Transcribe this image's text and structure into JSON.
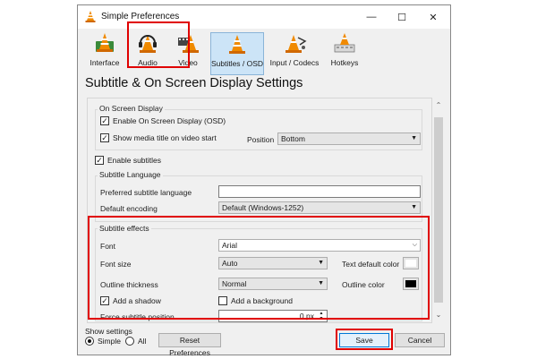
{
  "window": {
    "title": "Simple Preferences",
    "controls": {
      "minimize": "—",
      "maximize": "☐",
      "close": "✕"
    }
  },
  "toolbar": {
    "items": [
      {
        "label": "Interface",
        "icon": "interface-cone-icon"
      },
      {
        "label": "Audio",
        "icon": "headphones-cone-icon"
      },
      {
        "label": "Video",
        "icon": "video-cone-icon"
      },
      {
        "label": "Subtitles / OSD",
        "icon": "subtitles-cone-icon",
        "selected": true
      },
      {
        "label": "Input / Codecs",
        "icon": "input-cone-icon"
      },
      {
        "label": "Hotkeys",
        "icon": "hotkeys-cone-icon"
      }
    ]
  },
  "heading": "Subtitle & On Screen Display Settings",
  "osd": {
    "group_label": "On Screen Display",
    "enable_osd": "Enable On Screen Display (OSD)",
    "enable_osd_checked": true,
    "show_title": "Show media title on video start",
    "show_title_checked": true,
    "position_label": "Position",
    "position_value": "Bottom"
  },
  "enable_subtitles": {
    "label": "Enable subtitles",
    "checked": true
  },
  "language": {
    "group_label": "Subtitle Language",
    "preferred_label": "Preferred subtitle language",
    "preferred_value": "",
    "encoding_label": "Default encoding",
    "encoding_value": "Default (Windows-1252)"
  },
  "effects": {
    "group_label": "Subtitle effects",
    "font_label": "Font",
    "font_value": "Arial",
    "font_size_label": "Font size",
    "font_size_value": "Auto",
    "text_color_label": "Text default color",
    "text_color": "#ffffff",
    "outline_label": "Outline thickness",
    "outline_value": "Normal",
    "outline_color_label": "Outline color",
    "outline_color": "#000000",
    "shadow_label": "Add a shadow",
    "shadow_checked": true,
    "background_label": "Add a background",
    "background_checked": false,
    "force_pos_label": "Force subtitle position",
    "force_pos_value": "0 px"
  },
  "footer": {
    "show_settings": "Show settings",
    "simple": "Simple",
    "all": "All",
    "simple_selected": true,
    "reset": "Reset Preferences",
    "save": "Save",
    "cancel": "Cancel"
  },
  "colors": {
    "highlight": "#e00000",
    "cone_orange": "#f08a00",
    "selected_tab_bg": "#cce4f7"
  }
}
